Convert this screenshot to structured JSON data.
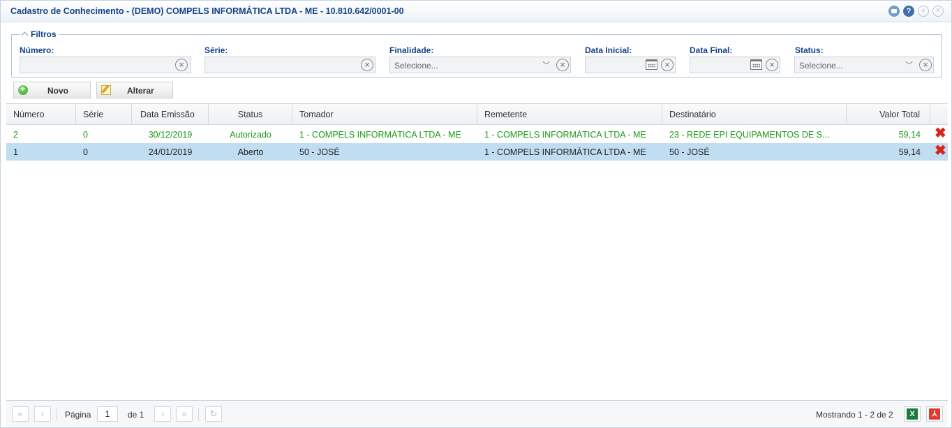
{
  "window": {
    "title": "Cadastro de Conhecimento - (DEMO) COMPELS INFORMÁTICA LTDA - ME - 10.810.642/0001-00",
    "help_symbol": "?",
    "tool_icons": [
      "restore-icon",
      "help-icon",
      "move-icon",
      "close-icon"
    ]
  },
  "filters": {
    "legend": "Filtros",
    "numero": {
      "label": "Número:",
      "value": ""
    },
    "serie": {
      "label": "Série:",
      "value": ""
    },
    "finalidade": {
      "label": "Finalidade:",
      "placeholder": "Selecione..."
    },
    "data_inicial": {
      "label": "Data Inicial:",
      "value": ""
    },
    "data_final": {
      "label": "Data Final:",
      "value": ""
    },
    "status": {
      "label": "Status:",
      "placeholder": "Selecione..."
    }
  },
  "toolbar": {
    "novo_label": "Novo",
    "alterar_label": "Alterar"
  },
  "grid": {
    "columns": [
      "Número",
      "Série",
      "Data Emissão",
      "Status",
      "Tomador",
      "Remetente",
      "Destinatário",
      "Valor Total"
    ],
    "rows": [
      {
        "numero": "2",
        "serie": "0",
        "data_emissao": "30/12/2019",
        "status": "Autorizado",
        "tomador": "1 - COMPELS INFORMÁTICA LTDA - ME",
        "remetente": "1 - COMPELS INFORMÁTICA LTDA - ME",
        "destinatario": "23 - REDE EPI EQUIPAMENTOS DE S...",
        "valor_total": "59,14",
        "text_color": "#1b9a14",
        "selected": false
      },
      {
        "numero": "1",
        "serie": "0",
        "data_emissao": "24/01/2019",
        "status": "Aberto",
        "tomador": "50 - JOSÉ",
        "remetente": "1 - COMPELS INFORMÁTICA LTDA - ME",
        "destinatario": "50 - JOSÉ",
        "valor_total": "59,14",
        "text_color": "#222222",
        "selected": true
      }
    ]
  },
  "pager": {
    "page_label": "Página",
    "current_page": "1",
    "of_label": "de 1",
    "summary": "Mostrando 1 - 2 de 2",
    "excel_label": "X",
    "pdf_label": "⅄"
  },
  "colors": {
    "accent": "#15428b",
    "authorized_text": "#1b9a14",
    "selected_row": "#c1ddf1",
    "delete_icon": "#d8241c"
  }
}
